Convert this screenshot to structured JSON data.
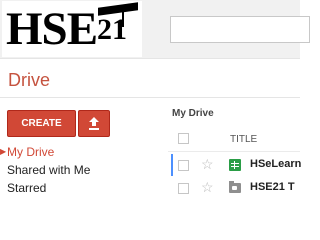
{
  "header": {
    "logo_text": "HSE21",
    "search": {
      "placeholder": ""
    }
  },
  "app": {
    "title": "Drive"
  },
  "toolbar": {
    "create_label": "CREATE",
    "upload_icon": "upload-arrow-icon"
  },
  "sidebar": {
    "items": [
      {
        "label": "My Drive",
        "active": true
      },
      {
        "label": "Shared with Me",
        "active": false
      },
      {
        "label": "Starred",
        "active": false
      }
    ]
  },
  "main": {
    "breadcrumb": "My Drive",
    "columns": {
      "title": "TITLE"
    },
    "rows": [
      {
        "title": "HSeLearn",
        "type": "spreadsheet",
        "starred": false
      },
      {
        "title": "HSE21 T",
        "type": "shared-folder",
        "starred": false
      }
    ]
  },
  "colors": {
    "accent": "#d14836",
    "title": "#c5533f",
    "selection": "#4d90fe",
    "sheet": "#2a9d46"
  }
}
